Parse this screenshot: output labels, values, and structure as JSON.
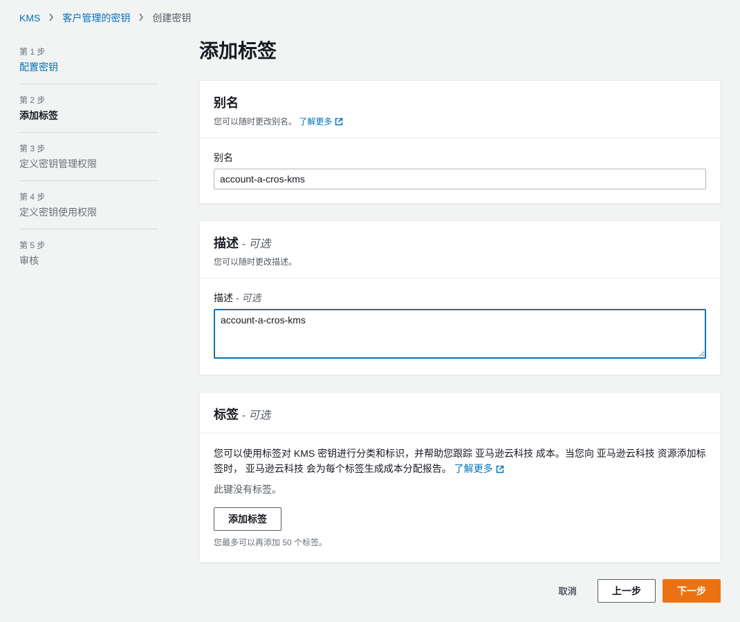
{
  "breadcrumb": {
    "kms": "KMS",
    "customer": "客户管理的密钥",
    "create": "创建密钥"
  },
  "steps": [
    {
      "num": "第 1 步",
      "title": "配置密钥"
    },
    {
      "num": "第 2 步",
      "title": "添加标签"
    },
    {
      "num": "第 3 步",
      "title": "定义密钥管理权限"
    },
    {
      "num": "第 4 步",
      "title": "定义密钥使用权限"
    },
    {
      "num": "第 5 步",
      "title": "审核"
    }
  ],
  "page_title": "添加标签",
  "alias": {
    "title": "别名",
    "desc_pre": "您可以随时更改别名。 ",
    "learn_more": "了解更多",
    "field_label": "别名",
    "value": "account-a-cros-kms"
  },
  "description": {
    "title": "描述",
    "optional": " - 可选",
    "desc": "您可以随时更改描述。",
    "field_label": "描述",
    "field_optional": " - 可选",
    "value": "account-a-cros-kms"
  },
  "tags": {
    "title": "标签",
    "optional": " - 可选",
    "body_text": "您可以使用标签对 KMS 密钥进行分类和标识，并帮助您跟踪 亚马逊云科技 成本。当您向 亚马逊云科技 资源添加标签时， 亚马逊云科技 会为每个标签生成成本分配报告。 ",
    "learn_more": "了解更多",
    "no_tags": "此键没有标签。",
    "add_btn": "添加标签",
    "hint": "您最多可以再添加 50 个标签。"
  },
  "actions": {
    "cancel": "取消",
    "prev": "上一步",
    "next": "下一步"
  }
}
